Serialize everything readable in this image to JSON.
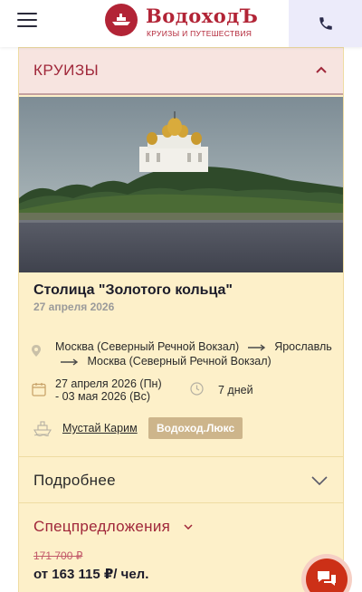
{
  "header": {
    "menu_icon": "hamburger-menu-icon",
    "logo_title": "ВодоходЪ",
    "logo_subtitle": "КРУИЗЫ И ПУТЕШЕСТВИЯ",
    "phone_icon": "phone-icon",
    "brand_color": "#b22436"
  },
  "cruises_section": {
    "label": "КРУИЗЫ",
    "toggle_icon": "chevron-up-icon"
  },
  "cruise": {
    "image_desc_icon": "cathedral-on-riverbank-photo",
    "title": "Столица \"Золотого кольца\"",
    "start_date": "27 апреля 2026",
    "route": {
      "from": "Москва (Северный Речной Вокзал)",
      "via": "Ярославль",
      "to": "Москва (Северный Речной Вокзал)"
    },
    "dates_line1": "27 апреля 2026 (Пн)",
    "dates_line2": "- 03 мая 2026 (Вс)",
    "duration": "7 дней",
    "ship_name": "Мустай Карим",
    "ship_class": "Водоход.Люкс"
  },
  "details": {
    "label": "Подробнее",
    "toggle_icon": "chevron-down-icon"
  },
  "special_offers": {
    "label": "Спецпредложения",
    "toggle_icon": "chevron-down-icon"
  },
  "price": {
    "old": "171 700 ₽",
    "new": "от 163 115 ₽/ чел."
  },
  "chat": {
    "icon": "chat-bubbles-icon"
  },
  "colors": {
    "card_bg": "#fdf0c9",
    "accent": "#a0273a",
    "badge": "#cdb58b",
    "chat": "#cc3017"
  }
}
